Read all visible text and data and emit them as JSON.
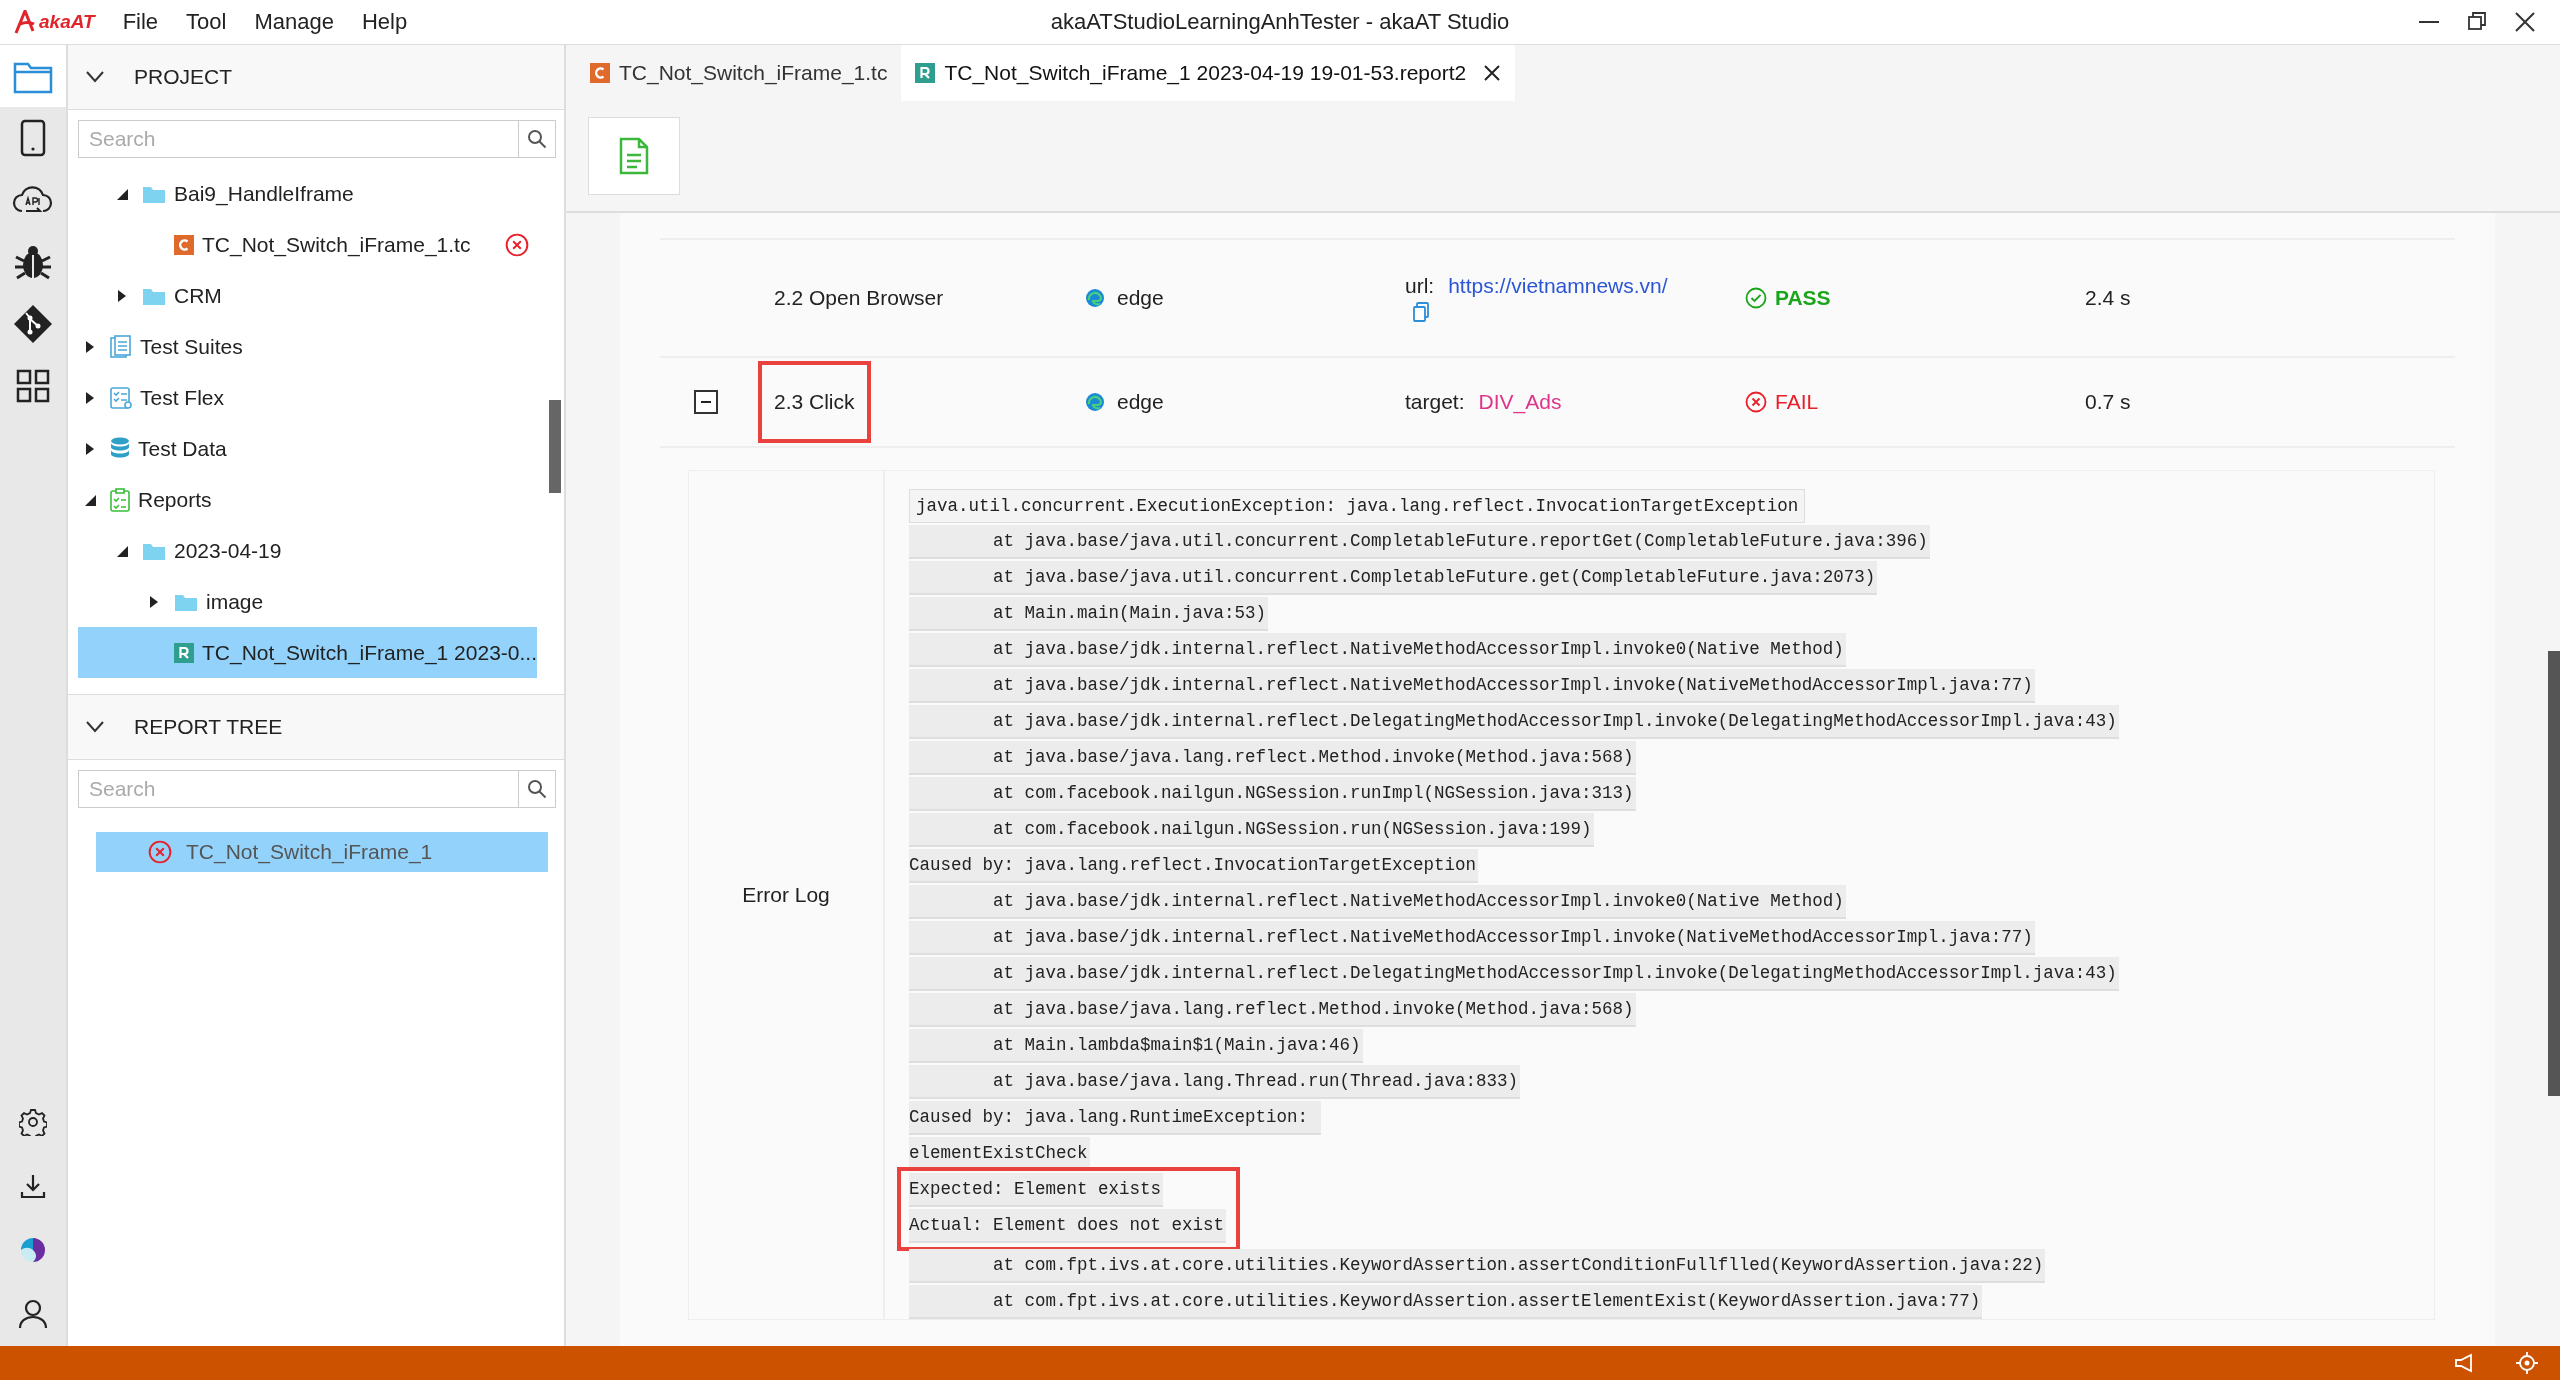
{
  "menu": {
    "logo": "akaAT",
    "items": [
      "File",
      "Tool",
      "Manage",
      "Help"
    ]
  },
  "window": {
    "title": "akaATStudioLearningAnhTester - akaAT Studio"
  },
  "activity_bar": [
    {
      "kind": "explorer",
      "selected": true
    },
    {
      "kind": "mobile",
      "selected": false
    },
    {
      "kind": "api",
      "selected": false
    },
    {
      "kind": "debug",
      "selected": false
    },
    {
      "kind": "git",
      "selected": false
    },
    {
      "kind": "grid",
      "selected": false
    }
  ],
  "activity_bar_bottom": [
    {
      "kind": "settings"
    },
    {
      "kind": "download"
    },
    {
      "kind": "plugin"
    },
    {
      "kind": "account"
    }
  ],
  "project": {
    "title": "PROJECT",
    "search": {
      "placeholder": "Search"
    },
    "tree": [
      {
        "kind": "offscreen",
        "children": [
          {
            "kind": "folder",
            "label": "Bai9_HandleIframe",
            "expanded": true,
            "children": [
              {
                "kind": "testcase",
                "label": "TC_Not_Switch_iFrame_1.tc",
                "error": true,
                "selected": false
              }
            ]
          },
          {
            "kind": "folder",
            "label": "CRM",
            "expanded": false
          }
        ]
      },
      {
        "kind": "suites",
        "label": "Test Suites",
        "expanded": false
      },
      {
        "kind": "flex",
        "label": "Test Flex",
        "expanded": false
      },
      {
        "kind": "data",
        "label": "Test Data",
        "expanded": false
      },
      {
        "kind": "reports",
        "label": "Reports",
        "expanded": true,
        "children": [
          {
            "kind": "folder",
            "label": "2023-04-19",
            "expanded": true,
            "children": [
              {
                "kind": "folder",
                "label": "image",
                "expanded": false
              },
              {
                "kind": "report",
                "label": "TC_Not_Switch_iFrame_1 2023-0...",
                "selected": true
              }
            ]
          }
        ]
      }
    ]
  },
  "report_tree": {
    "title": "REPORT TREE",
    "search": {
      "placeholder": "Search"
    },
    "items": [
      {
        "label": "TC_Not_Switch_iFrame_1",
        "failed": true,
        "selected": true
      }
    ]
  },
  "tabs": [
    {
      "kind": "testcase",
      "label": "TC_Not_Switch_iFrame_1.tc",
      "selected": false,
      "closable": false
    },
    {
      "kind": "report",
      "label": "TC_Not_Switch_iFrame_1 2023-04-19 19-01-53.report2",
      "selected": true,
      "closable": true
    }
  ],
  "steps": [
    {
      "name": "2.2 Open Browser",
      "highlighted": false,
      "browser": "edge",
      "param": {
        "kind": "link",
        "label": "url:",
        "value": "https://vietnamnews.vn/",
        "copy": true
      },
      "status": "PASS",
      "duration": "2.4 s"
    },
    {
      "name": "2.3 Click",
      "expandable": true,
      "expanded": true,
      "highlighted": true,
      "browser": "edge",
      "param": {
        "kind": "locator",
        "label": "target:",
        "value": "DIV_Ads"
      },
      "status": "FAIL",
      "duration": "0.7 s"
    }
  ],
  "error_log": {
    "label": "Error Log",
    "lines": [
      {
        "text": "java.util.concurrent.ExecutionException: java.lang.reflect.InvocationTargetException",
        "highlighted": false
      },
      {
        "text": "\tat java.base/java.util.concurrent.CompletableFuture.reportGet(CompletableFuture.java:396)",
        "highlighted": false
      },
      {
        "text": "\tat java.base/java.util.concurrent.CompletableFuture.get(CompletableFuture.java:2073)",
        "highlighted": false
      },
      {
        "text": "\tat Main.main(Main.java:53)",
        "highlighted": false
      },
      {
        "text": "\tat java.base/jdk.internal.reflect.NativeMethodAccessorImpl.invoke0(Native Method)",
        "highlighted": false
      },
      {
        "text": "\tat java.base/jdk.internal.reflect.NativeMethodAccessorImpl.invoke(NativeMethodAccessorImpl.java:77)",
        "highlighted": false
      },
      {
        "text": "\tat java.base/jdk.internal.reflect.DelegatingMethodAccessorImpl.invoke(DelegatingMethodAccessorImpl.java:43)",
        "highlighted": false
      },
      {
        "text": "\tat java.base/java.lang.reflect.Method.invoke(Method.java:568)",
        "highlighted": false
      },
      {
        "text": "\tat com.facebook.nailgun.NGSession.runImpl(NGSession.java:313)",
        "highlighted": false
      },
      {
        "text": "\tat com.facebook.nailgun.NGSession.run(NGSession.java:199)",
        "highlighted": false
      },
      {
        "text": "Caused by: java.lang.reflect.InvocationTargetException",
        "highlighted": false
      },
      {
        "text": "\tat java.base/jdk.internal.reflect.NativeMethodAccessorImpl.invoke0(Native Method)",
        "highlighted": false
      },
      {
        "text": "\tat java.base/jdk.internal.reflect.NativeMethodAccessorImpl.invoke(NativeMethodAccessorImpl.java:77)",
        "highlighted": false
      },
      {
        "text": "\tat java.base/jdk.internal.reflect.DelegatingMethodAccessorImpl.invoke(DelegatingMethodAccessorImpl.java:43)",
        "highlighted": false
      },
      {
        "text": "\tat java.base/java.lang.reflect.Method.invoke(Method.java:568)",
        "highlighted": false
      },
      {
        "text": "\tat Main.lambda$main$1(Main.java:46)",
        "highlighted": false
      },
      {
        "text": "\tat java.base/java.lang.Thread.run(Thread.java:833)",
        "highlighted": false
      },
      {
        "text": "Caused by: java.lang.RuntimeException: ",
        "highlighted": false
      },
      {
        "text": "elementExistCheck",
        "highlighted": false
      },
      {
        "text": "Expected: Element exists",
        "highlighted": true
      },
      {
        "text": "Actual: Element does not exist",
        "highlighted": true
      },
      {
        "text": "\tat com.fpt.ivs.at.core.utilities.KeywordAssertion.assertConditionFullflled(KeywordAssertion.java:22)",
        "highlighted": false
      },
      {
        "text": "\tat com.fpt.ivs.at.core.utilities.KeywordAssertion.assertElementExist(KeywordAssertion.java:77)",
        "highlighted": false
      }
    ]
  }
}
